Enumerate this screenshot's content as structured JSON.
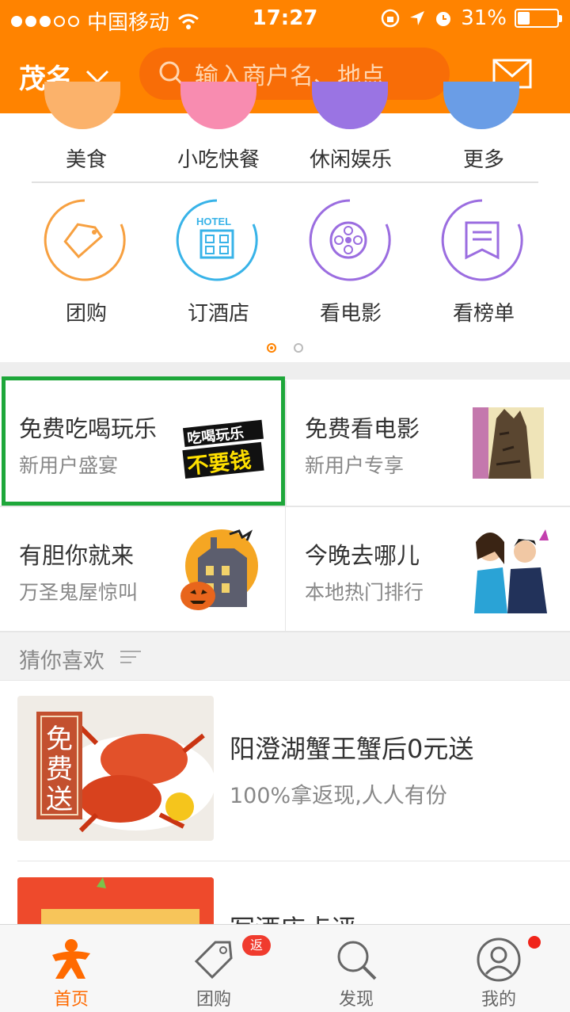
{
  "status": {
    "carrier": "中国移动",
    "time": "17:27",
    "battery_percent": "31%",
    "battery_level": 0.31
  },
  "header": {
    "city": "茂名",
    "search_placeholder": "输入商户名、地点"
  },
  "categories_row1": [
    "美食",
    "小吃快餐",
    "休闲娱乐",
    "更多"
  ],
  "categories_row2": [
    {
      "label": "团购",
      "icon": "tag-icon",
      "color": "#f7a040"
    },
    {
      "label": "订酒店",
      "icon": "hotel-icon",
      "color": "#38b3e8"
    },
    {
      "label": "看电影",
      "icon": "film-reel-icon",
      "color": "#9b6de0"
    },
    {
      "label": "看榜单",
      "icon": "ranking-list-icon",
      "color": "#9b6de0"
    }
  ],
  "pager": {
    "page": 1,
    "total": 2
  },
  "promos": [
    {
      "title": "免费吃喝玩乐",
      "subtitle": "新用户盛宴",
      "image_text_top": "吃喝玩乐",
      "image_text_bottom": "不要钱"
    },
    {
      "title": "免费看电影",
      "subtitle": "新用户专享"
    },
    {
      "title": "有胆你就来",
      "subtitle": "万圣鬼屋惊叫"
    },
    {
      "title": "今晚去哪儿",
      "subtitle": "本地热门排行"
    }
  ],
  "guess": {
    "title": "猜你喜欢"
  },
  "items": [
    {
      "title": "阳澄湖蟹王蟹后0元送",
      "subtitle": "100%拿返现,人人有份",
      "stamp_text": "免费送"
    },
    {
      "title": "写酒店点评",
      "subtitle": ""
    }
  ],
  "tabs": [
    {
      "label": "首页",
      "icon": "home-person-icon"
    },
    {
      "label": "团购",
      "icon": "tag-icon",
      "badge": "返"
    },
    {
      "label": "发现",
      "icon": "search-icon"
    },
    {
      "label": "我的",
      "icon": "user-icon"
    }
  ],
  "colors": {
    "brand": "#ff8300",
    "highlight": "#1ea73a"
  }
}
